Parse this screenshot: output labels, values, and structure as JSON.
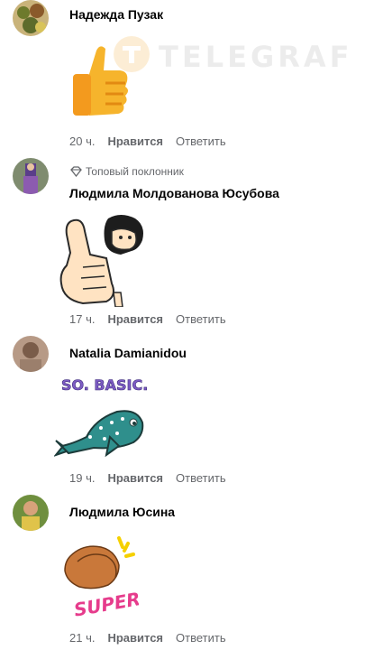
{
  "watermark": {
    "text": "TELEGRAF"
  },
  "comments": [
    {
      "author": "Надежда Пузак",
      "badge": "",
      "time": "20 ч.",
      "like": "Нравится",
      "reply": "Ответить",
      "sticker": "thumbs-up"
    },
    {
      "author": "Людмила Молдованова Юсубова",
      "badge": "Топовый поклонник",
      "time": "17 ч.",
      "like": "Нравится",
      "reply": "Ответить",
      "sticker": "girl-thumbs-up"
    },
    {
      "author": "Natalia Damianidou",
      "badge": "",
      "time": "19 ч.",
      "like": "Нравится",
      "reply": "Ответить",
      "sticker": "so-basic-whale-shark",
      "sticker_text": "SO. BASIC."
    },
    {
      "author": "Людмила Юсина",
      "badge": "",
      "time": "21 ч.",
      "like": "Нравится",
      "reply": "Ответить",
      "sticker": "super-clapping-hands",
      "sticker_text": "SUPER!"
    }
  ]
}
